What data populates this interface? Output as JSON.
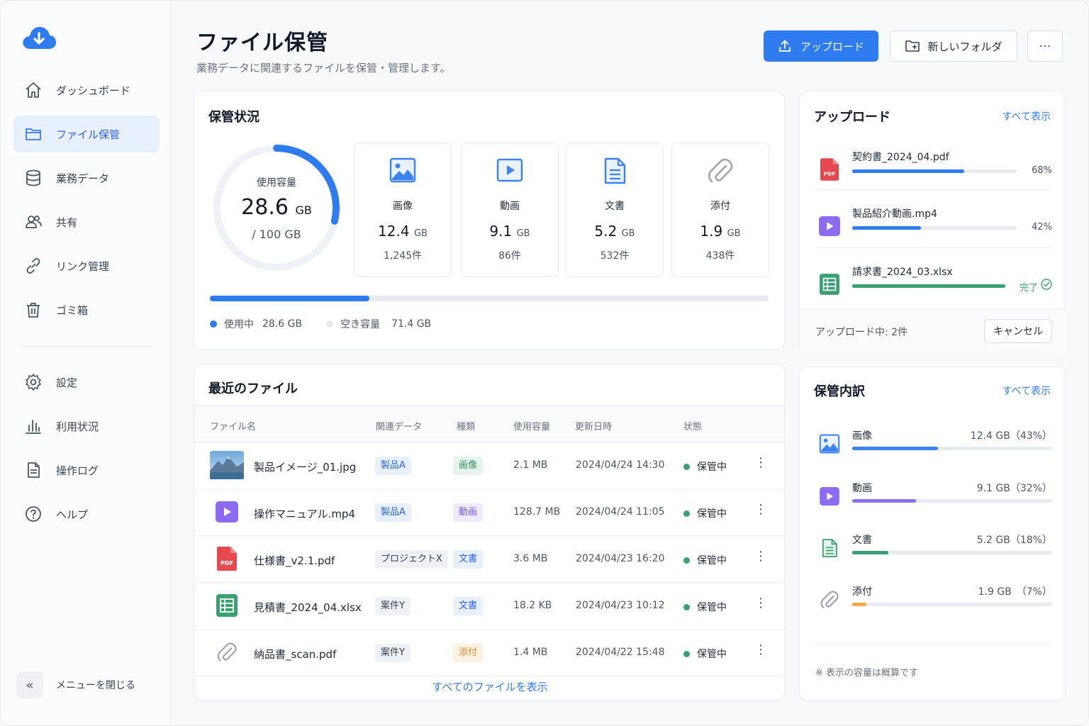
{
  "colors": {
    "accent": "#2f7cf0",
    "image": "#3b82f6",
    "video": "#8b6cf0",
    "document": "#3aa070",
    "attachment": "#f3a94a",
    "pdf": "#e5484d",
    "success": "#3aa070"
  },
  "sidebar": {
    "items": [
      {
        "label": "ダッシュボード",
        "icon": "home-icon"
      },
      {
        "label": "ファイル保管",
        "icon": "folder-icon",
        "active": true
      },
      {
        "label": "業務データ",
        "icon": "database-icon"
      },
      {
        "label": "共有",
        "icon": "users-icon"
      },
      {
        "label": "リンク管理",
        "icon": "link-icon"
      },
      {
        "label": "ゴミ箱",
        "icon": "trash-icon"
      }
    ],
    "items2": [
      {
        "label": "設定",
        "icon": "gear-icon"
      },
      {
        "label": "利用状況",
        "icon": "bar-chart-icon"
      },
      {
        "label": "操作ログ",
        "icon": "log-document-icon"
      },
      {
        "label": "ヘルプ",
        "icon": "help-icon"
      }
    ],
    "collapse_label": "メニューを閉じる"
  },
  "header": {
    "title": "ファイル保管",
    "subtitle": "業務データに関連するファイルを保管・管理します。",
    "upload_label": "アップロード",
    "new_folder_label": "新しいフォルダ",
    "more_label": "···"
  },
  "storage": {
    "title": "保管状況",
    "usage_label": "使用容量",
    "used_value": "28.6",
    "used_unit": "GB",
    "total": "/ 100 GB",
    "used_fraction": 0.286,
    "categories": [
      {
        "name": "画像",
        "value": "12.4",
        "unit": "GB",
        "count": "1,245件",
        "icon": "image-icon"
      },
      {
        "name": "動画",
        "value": "9.1",
        "unit": "GB",
        "count": "86件",
        "icon": "video-icon"
      },
      {
        "name": "文書",
        "value": "5.2",
        "unit": "GB",
        "count": "532件",
        "icon": "document-icon"
      },
      {
        "name": "添付",
        "value": "1.9",
        "unit": "GB",
        "count": "438件",
        "icon": "paperclip-icon"
      }
    ],
    "legend_used_label": "使用中",
    "legend_used_value": "28.6 GB",
    "legend_free_label": "空き容量",
    "legend_free_value": "71.4 GB"
  },
  "recent": {
    "title": "最近のファイル",
    "columns": [
      "ファイル名",
      "関連データ",
      "種類",
      "使用容量",
      "更新日時",
      "状態"
    ],
    "rows": [
      {
        "name": "製品イメージ_01.jpg",
        "related": "製品A",
        "kind": "画像",
        "size": "2.1 MB",
        "updated": "2024/04/24 14:30",
        "status": "保管中",
        "icon": "photo-thumbnail"
      },
      {
        "name": "操作マニュアル.mp4",
        "related": "製品A",
        "kind": "動画",
        "size": "128.7 MB",
        "updated": "2024/04/24 11:05",
        "status": "保管中",
        "icon": "video-file-icon"
      },
      {
        "name": "仕様書_v2.1.pdf",
        "related": "プロジェクトX",
        "kind": "文書",
        "size": "3.6 MB",
        "updated": "2024/04/23 16:20",
        "status": "保管中",
        "icon": "pdf-file-icon"
      },
      {
        "name": "見積書_2024_04.xlsx",
        "related": "案件Y",
        "kind": "文書",
        "size": "18.2 KB",
        "updated": "2024/04/23 10:12",
        "status": "保管中",
        "icon": "spreadsheet-file-icon"
      },
      {
        "name": "納品書_scan.pdf",
        "related": "案件Y",
        "kind": "添付",
        "size": "1.4 MB",
        "updated": "2024/04/22 15:48",
        "status": "保管中",
        "icon": "paperclip-icon"
      }
    ],
    "show_all": "すべてのファイルを表示"
  },
  "uploads": {
    "title": "アップロード",
    "view_all": "すべて表示",
    "items": [
      {
        "name": "契約書_2024_04.pdf",
        "progress": 0.68,
        "label": "68%",
        "icon": "pdf-file-icon"
      },
      {
        "name": "製品紹介動画.mp4",
        "progress": 0.42,
        "label": "42%",
        "icon": "video-file-icon"
      },
      {
        "name": "請求書_2024_03.xlsx",
        "progress": 1.0,
        "label": "完了",
        "icon": "spreadsheet-file-icon"
      }
    ],
    "footer_text": "アップロード中: 2件",
    "cancel_label": "キャンセル"
  },
  "breakdown": {
    "title": "保管内訳",
    "view_all": "すべて表示",
    "items": [
      {
        "name": "画像",
        "value": "12.4 GB（43%）",
        "fraction": 0.43,
        "icon": "image-icon"
      },
      {
        "name": "動画",
        "value": "9.1 GB（32%）",
        "fraction": 0.32,
        "icon": "video-icon"
      },
      {
        "name": "文書",
        "value": "5.2 GB（18%）",
        "fraction": 0.18,
        "icon": "document-icon"
      },
      {
        "name": "添付",
        "value": "1.9 GB　（7%）",
        "fraction": 0.07,
        "icon": "paperclip-icon"
      }
    ],
    "note": "※ 表示の容量は概算です"
  }
}
